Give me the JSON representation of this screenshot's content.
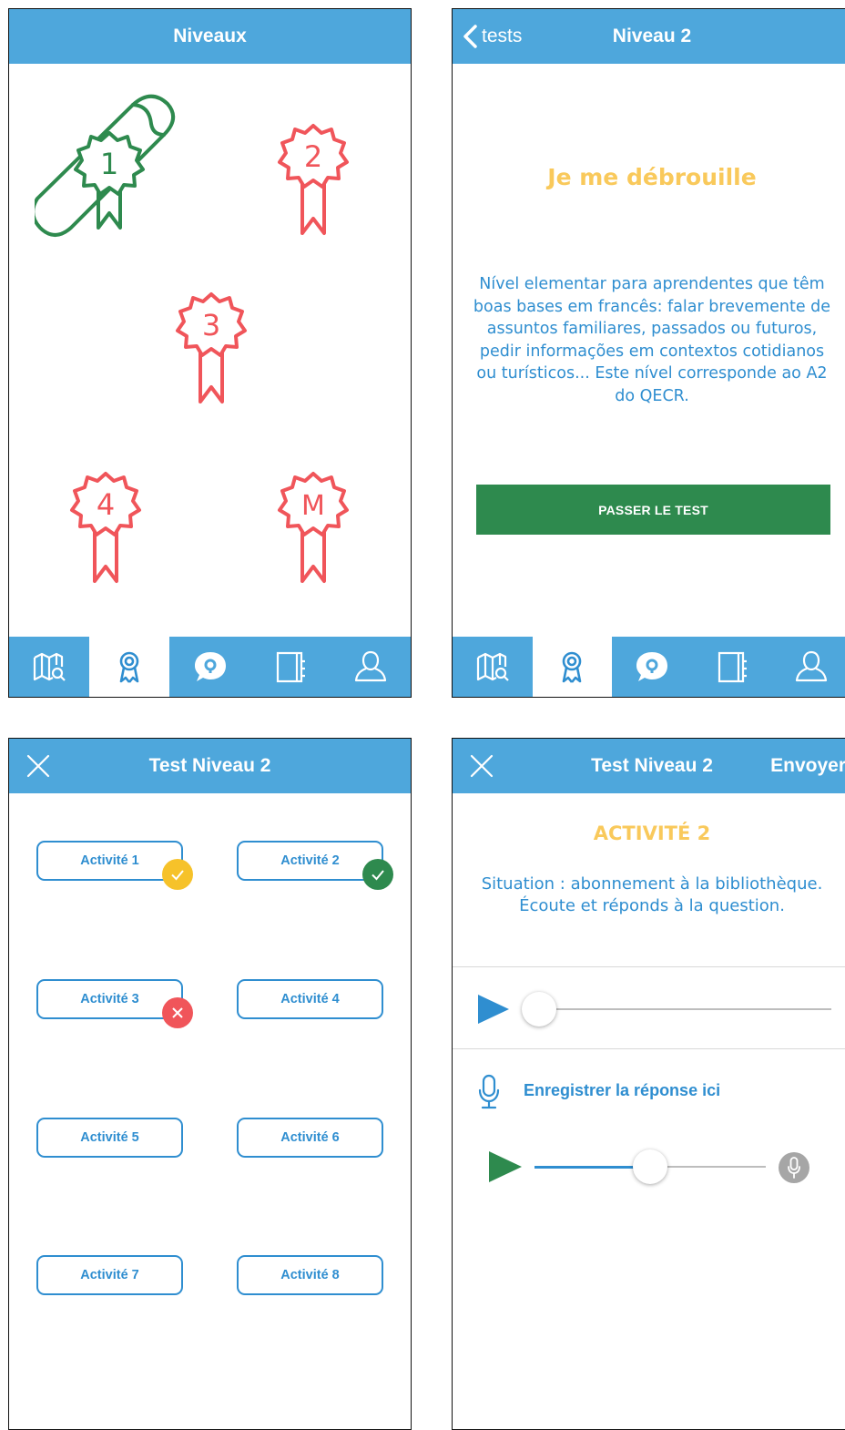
{
  "colors": {
    "header": "#4ea7dc",
    "completed": "#2e8a4e",
    "locked": "#f0555a",
    "accent_title": "#f9c95b",
    "text_blue": "#2f8ed0",
    "warning": "#f6c22a",
    "success": "#2e8a4e",
    "error": "#f0555a"
  },
  "screen1": {
    "header_title": "Niveaux",
    "badges": [
      {
        "label": "1",
        "status": "completed",
        "icon": "diploma-scroll-icon"
      },
      {
        "label": "2",
        "status": "locked",
        "icon": "award-ribbon-icon"
      },
      {
        "label": "3",
        "status": "locked",
        "icon": "award-ribbon-icon"
      },
      {
        "label": "4",
        "status": "locked",
        "icon": "award-ribbon-icon"
      },
      {
        "label": "M",
        "status": "locked",
        "icon": "award-ribbon-icon"
      }
    ]
  },
  "screen2": {
    "back_label": "tests",
    "header_title": "Niveau 2",
    "level_title": "Je me débrouille",
    "description": "Nível elementar para aprendentes que têm boas bases em francês: falar brevemente de assuntos familiares, passados ou futuros, pedir informações em contextos cotidianos ou turísticos... Este nível corresponde ao A2 do QECR.",
    "button_label": "PASSER LE TEST"
  },
  "tabbar": {
    "active_index": 1,
    "tabs": [
      "map-search-icon",
      "award-icon",
      "chat-bubble-icon",
      "book-icon",
      "user-icon"
    ]
  },
  "screen3": {
    "header_title": "Test Niveau 2",
    "activities": [
      {
        "label": "Activité 1",
        "status": "warning"
      },
      {
        "label": "Activité 2",
        "status": "success"
      },
      {
        "label": "Activité 3",
        "status": "error"
      },
      {
        "label": "Activité 4",
        "status": ""
      },
      {
        "label": "Activité 5",
        "status": ""
      },
      {
        "label": "Activité 6",
        "status": ""
      },
      {
        "label": "Activité 7",
        "status": ""
      },
      {
        "label": "Activité 8",
        "status": ""
      }
    ]
  },
  "screen4": {
    "header_title": "Test Niveau 2",
    "send_label": "Envoyer",
    "activity_title": "ACTIVITÉ 2",
    "situation": "Situation : abonnement à la bibliothèque. Écoute et réponds à la question.",
    "record_label": "Enregistrer la réponse ici",
    "audio_progress": 0.0,
    "recording_progress": 0.5
  }
}
